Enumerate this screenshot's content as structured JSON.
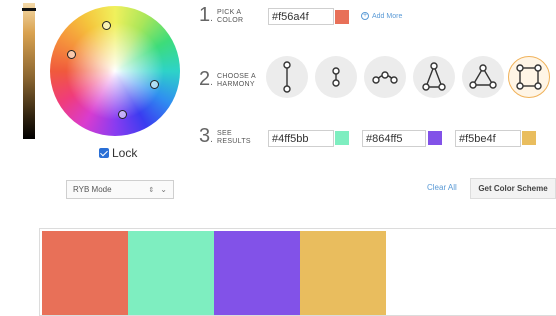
{
  "brightness_slider": {
    "color": "#d9a250"
  },
  "wheel": {
    "handles": [
      "#f56a4f",
      "#4ff5bb",
      "#864ff5",
      "#f5be4f"
    ]
  },
  "lock": {
    "label": "Lock",
    "checked": true
  },
  "step1": {
    "number": "1",
    "line1": "PICK A",
    "line2": "COLOR",
    "hex": "#f56a4f",
    "swatch": "#e87058",
    "add_more": "Add More",
    "add_more_icon": "+"
  },
  "step2": {
    "number": "2",
    "line1": "CHOOSE A",
    "line2": "HARMONY",
    "harmonies": [
      {
        "name": "complementary",
        "icon": "two-dots-line-icon"
      },
      {
        "name": "analogous",
        "icon": "two-dots-close-icon"
      },
      {
        "name": "triad-arc",
        "icon": "three-dots-arc-icon"
      },
      {
        "name": "split-complementary",
        "icon": "triangle-narrow-icon"
      },
      {
        "name": "triad",
        "icon": "triangle-icon"
      },
      {
        "name": "tetrad",
        "icon": "square-icon",
        "selected": true
      }
    ],
    "accent": "#f0b25a"
  },
  "step3": {
    "number": "3",
    "line1": "SEE",
    "line2": "RESULTS",
    "results": [
      {
        "hex": "#4ff5bb",
        "swatch": "#7eeec0"
      },
      {
        "hex": "#864ff5",
        "swatch": "#8252e8"
      },
      {
        "hex": "#f5be4f",
        "swatch": "#e9bd5e"
      }
    ]
  },
  "mode": {
    "label": "RYB Mode",
    "arrows": "⇕",
    "chevron": "⌄"
  },
  "actions": {
    "clear_all": "Clear All",
    "get_scheme": "Get Color Scheme"
  },
  "scheme": {
    "colors": [
      "#e87058",
      "#7eeec0",
      "#8252e8",
      "#e9bd5e"
    ]
  }
}
